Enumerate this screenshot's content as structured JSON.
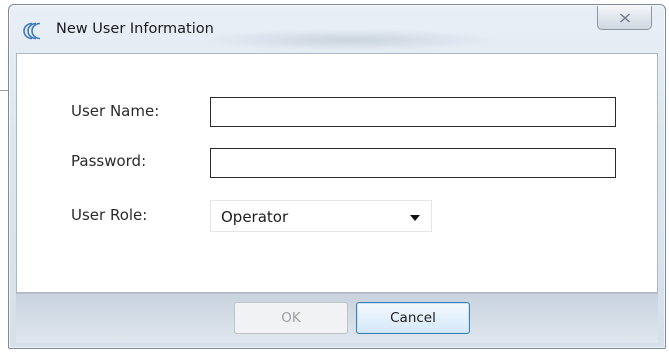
{
  "window": {
    "title": "New User Information",
    "icon": "app-logo-icon",
    "close_icon": "close-icon"
  },
  "form": {
    "user_name": {
      "label": "User Name:",
      "value": ""
    },
    "password": {
      "label": "Password:",
      "value": ""
    },
    "user_role": {
      "label": "User Role:",
      "selected": "Operator"
    }
  },
  "footer": {
    "ok_label": "OK",
    "ok_enabled": false,
    "cancel_label": "Cancel"
  },
  "colors": {
    "accent": "#3c7fb1",
    "title_bar": "#dde6ef",
    "client_background": "#ffffff"
  }
}
